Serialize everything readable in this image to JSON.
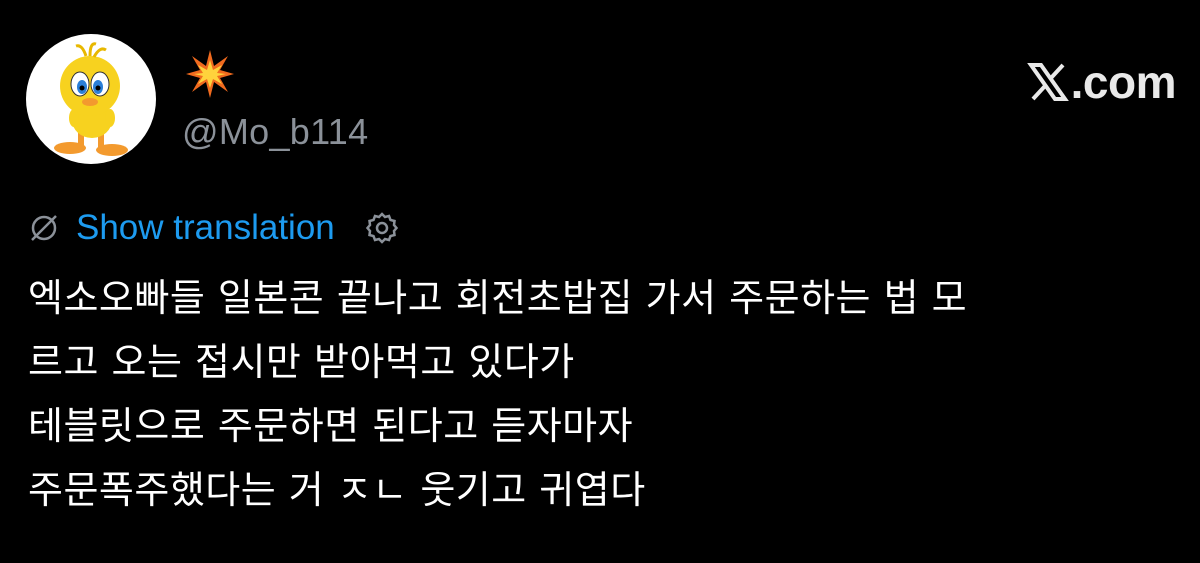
{
  "post": {
    "author": {
      "avatar_icon": "tweety-bird-avatar",
      "display_name_icon": "collision-emoji-icon",
      "handle": "@Mo_b114"
    },
    "brand": {
      "icon": "x-logo-icon",
      "label": ".com"
    },
    "translation": {
      "icon": "globe-slash-icon",
      "link_label": "Show translation",
      "settings_icon": "gear-icon"
    },
    "text_lines": [
      "엑소오빠들 일본콘 끝나고 회전초밥집 가서 주문하는 법 모",
      "르고 오는 접시만 받아먹고 있다가",
      "테블릿으로 주문하면 된다고 듣자마자",
      "주문폭주했다는 거 ㅈㄴ 웃기고 귀엽다"
    ]
  },
  "colors": {
    "background": "#000000",
    "text": "#ffffff",
    "handle": "#8b9199",
    "link": "#1d9bf0"
  }
}
